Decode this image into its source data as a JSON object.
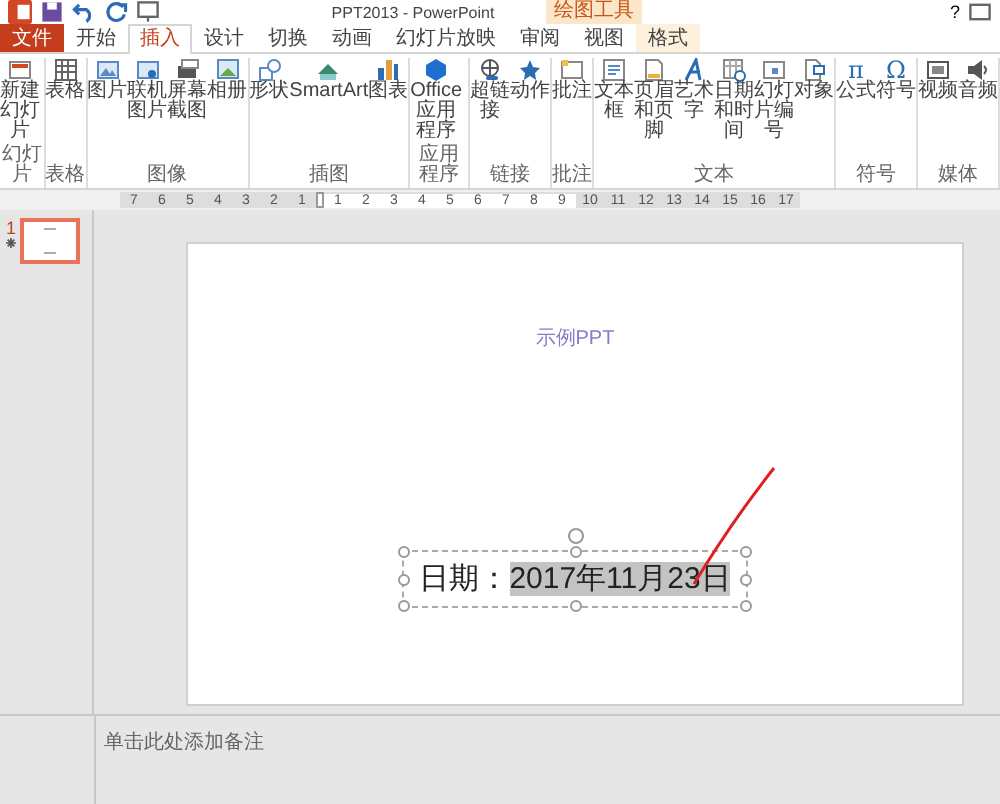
{
  "title_bar": {
    "title": "PPT2013 - PowerPoint",
    "context_group": "绘图工具",
    "help": "?"
  },
  "tabs": [
    {
      "label": "文件",
      "kind": "file",
      "selected": false
    },
    {
      "label": "开始",
      "kind": "tab",
      "selected": false
    },
    {
      "label": "插入",
      "kind": "tab",
      "selected": true
    },
    {
      "label": "设计",
      "kind": "tab",
      "selected": false
    },
    {
      "label": "切换",
      "kind": "tab",
      "selected": false
    },
    {
      "label": "动画",
      "kind": "tab",
      "selected": false
    },
    {
      "label": "幻灯片放映",
      "kind": "tab",
      "selected": false
    },
    {
      "label": "审阅",
      "kind": "tab",
      "selected": false
    },
    {
      "label": "视图",
      "kind": "tab",
      "selected": false
    },
    {
      "label": "格式",
      "kind": "context",
      "selected": false
    }
  ],
  "ribbon": [
    {
      "label": "幻灯片",
      "buttons": [
        {
          "label": "新建幻灯片"
        }
      ]
    },
    {
      "label": "表格",
      "buttons": [
        {
          "label": "表格"
        }
      ]
    },
    {
      "label": "图像",
      "buttons": [
        {
          "label": "图片"
        },
        {
          "label": "联机图片"
        },
        {
          "label": "屏幕截图"
        },
        {
          "label": "相册"
        }
      ]
    },
    {
      "label": "插图",
      "buttons": [
        {
          "label": "形状"
        },
        {
          "label": "SmartArt"
        },
        {
          "label": "图表"
        }
      ]
    },
    {
      "label": "应用程序",
      "buttons": [
        {
          "label": "Office应用程序"
        }
      ]
    },
    {
      "label": "链接",
      "buttons": [
        {
          "label": "超链接"
        },
        {
          "label": "动作"
        }
      ]
    },
    {
      "label": "批注",
      "buttons": [
        {
          "label": "批注"
        }
      ]
    },
    {
      "label": "文本",
      "buttons": [
        {
          "label": "文本框"
        },
        {
          "label": "页眉和页脚"
        },
        {
          "label": "艺术字"
        },
        {
          "label": "日期和时间"
        },
        {
          "label": "幻灯片编号"
        },
        {
          "label": "对象"
        }
      ]
    },
    {
      "label": "符号",
      "buttons": [
        {
          "label": "公式",
          "glyph": "π"
        },
        {
          "label": "符号",
          "glyph": "Ω"
        }
      ]
    },
    {
      "label": "媒体",
      "buttons": [
        {
          "label": "视频"
        },
        {
          "label": "音频"
        }
      ]
    }
  ],
  "ruler": {
    "before_origin": [
      "7",
      "6",
      "5",
      "4",
      "3",
      "2",
      "1"
    ],
    "after_origin": [
      "1",
      "2",
      "3",
      "4",
      "5",
      "6",
      "7",
      "8",
      "9",
      "10",
      "11",
      "12",
      "13",
      "14",
      "15",
      "16",
      "17"
    ]
  },
  "thumbnails": [
    {
      "number": "1",
      "selected": true
    }
  ],
  "slide": {
    "title": "示例PPT",
    "textbox": {
      "label": "日期：",
      "value": "2017年11月23日",
      "value_highlighted": true,
      "selected": true
    }
  },
  "notes": {
    "placeholder": "单击此处添加备注"
  }
}
